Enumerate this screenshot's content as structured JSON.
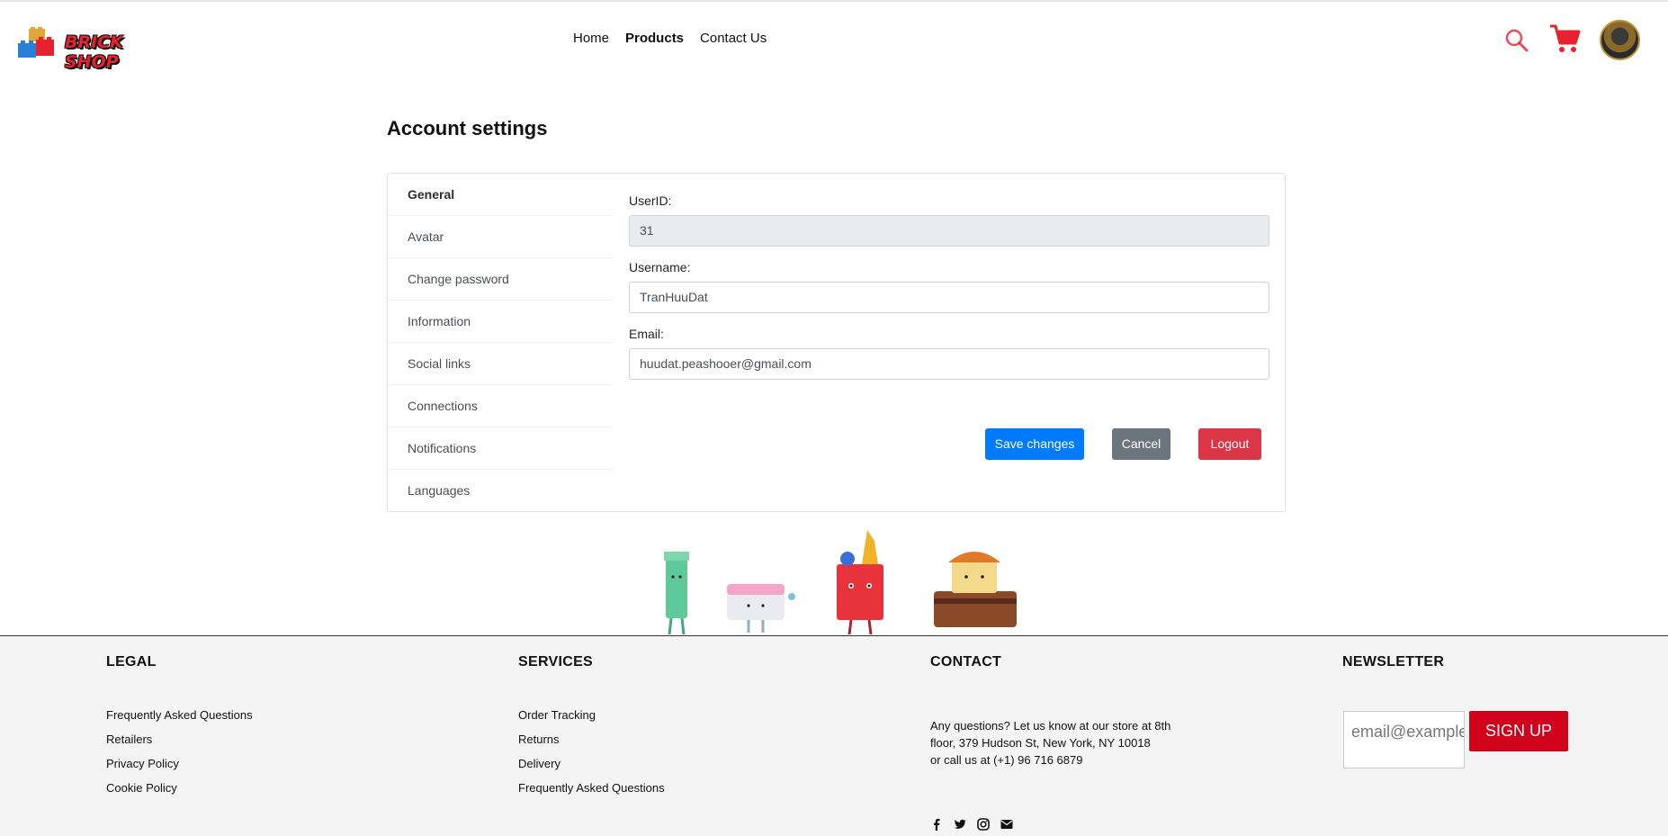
{
  "header": {
    "logo_text": "BRICK SHOP",
    "nav": [
      "Home",
      "Products",
      "Contact Us"
    ],
    "active_nav": "Products"
  },
  "page": {
    "title": "Account settings"
  },
  "sidebar": {
    "items": [
      {
        "label": "General"
      },
      {
        "label": "Avatar"
      },
      {
        "label": "Change password"
      },
      {
        "label": "Information"
      },
      {
        "label": "Social links"
      },
      {
        "label": "Connections"
      },
      {
        "label": "Notifications"
      },
      {
        "label": "Languages"
      }
    ]
  },
  "form": {
    "userid_label": "UserID:",
    "userid_value": "31",
    "username_label": "Username:",
    "username_value": "TranHuuDat",
    "email_label": "Email:",
    "email_value": "huudat.peashooer@gmail.com"
  },
  "buttons": {
    "save": "Save changes",
    "cancel": "Cancel",
    "logout": "Logout"
  },
  "footer": {
    "legal": {
      "title": "LEGAL",
      "links": [
        "Frequently Asked Questions",
        "Retailers",
        "Privacy Policy",
        "Cookie Policy"
      ]
    },
    "services": {
      "title": "SERVICES",
      "links": [
        "Order Tracking",
        "Returns",
        "Delivery",
        "Frequently Asked Questions"
      ]
    },
    "contact": {
      "title": "CONTACT",
      "line1": "Any questions? Let us know at our store at 8th",
      "line2": "floor, 379 Hudson St, New York, NY 10018",
      "line3": "or call us at (+1) 96 716 6879",
      "socials": [
        "facebook-icon",
        "twitter-icon",
        "instagram-icon",
        "envelope-icon"
      ]
    },
    "newsletter": {
      "title": "NEWSLETTER",
      "placeholder": "email@example.com",
      "button": "SIGN UP"
    }
  },
  "colors": {
    "brand_red": "#e8212e",
    "primary": "#007bff",
    "secondary": "#6c757d",
    "danger": "#dc3545",
    "signup": "#d0021b"
  }
}
